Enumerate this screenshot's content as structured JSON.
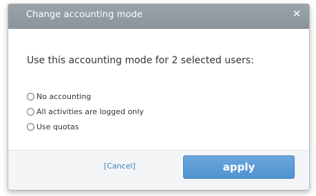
{
  "dialog": {
    "title": "Change accounting mode",
    "close_icon": "close-icon",
    "prompt": "Use this accounting mode for 2 selected users:",
    "options": [
      {
        "label": "No accounting",
        "selected": false
      },
      {
        "label": "All activities are logged only",
        "selected": false
      },
      {
        "label": "Use quotas",
        "selected": false
      }
    ],
    "footer": {
      "cancel_label": "[Cancel]",
      "apply_label": "apply"
    }
  },
  "colors": {
    "title_bar": "#929aa2",
    "apply_button": "#5a9bd5",
    "cancel_link": "#3b7fc0"
  }
}
